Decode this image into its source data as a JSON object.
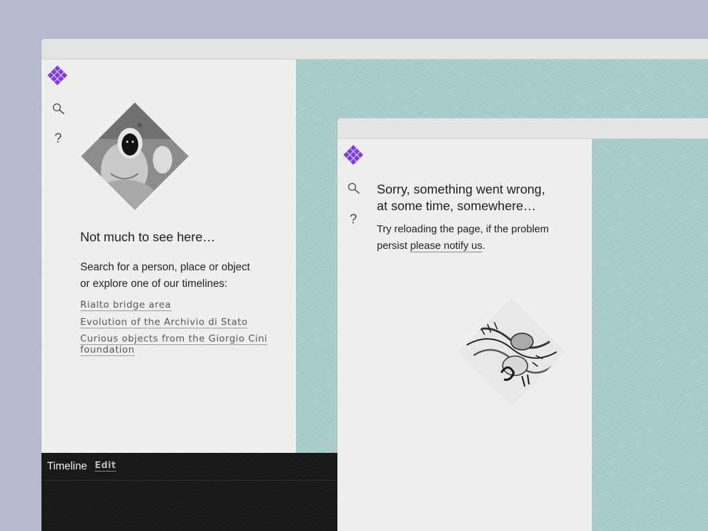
{
  "back_window": {
    "empty_state": {
      "heading": "Not much to see here…",
      "body_line1": "Search for a person, place or object",
      "body_line2": "or explore one of our timelines:",
      "links": [
        {
          "label": "Rialto bridge area"
        },
        {
          "label": "Evolution of the Archivio di Stato"
        },
        {
          "label_line1": "Curious objects from the Giorgio Cini",
          "label_line2": "foundation"
        }
      ]
    },
    "help_label": "?",
    "timeline": {
      "title": "Timeline",
      "edit_label": "Edit"
    }
  },
  "front_window": {
    "error": {
      "heading_line1": "Sorry, something went wrong,",
      "heading_line2": "at some time, somewhere…",
      "body_line1": "Try reloading the page, if the problem",
      "body_prefix": "persist ",
      "notify_link": "please notify us",
      "body_suffix": "."
    },
    "help_label": "?"
  },
  "icons": {
    "logo": "grid-diamond-logo-icon",
    "search": "search-icon",
    "help": "help-icon"
  },
  "colors": {
    "accent": "#7c3aed",
    "desk_background": "#b6bacc",
    "teal_panel": "#a8cdcb",
    "paper": "#f1f1f0",
    "timeline_bar": "#141414"
  }
}
